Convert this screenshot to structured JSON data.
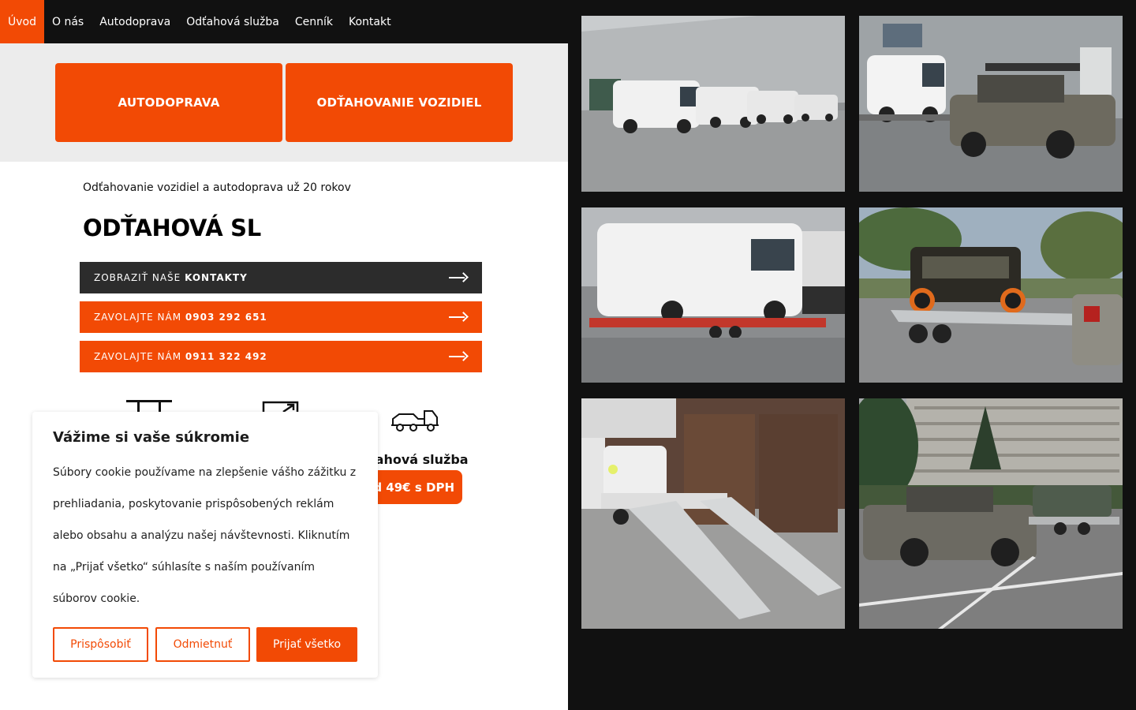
{
  "nav": {
    "items": [
      {
        "label": "Úvod",
        "active": true
      },
      {
        "label": "O nás"
      },
      {
        "label": "Autodoprava"
      },
      {
        "label": "Odťahová služba"
      },
      {
        "label": "Cenník"
      },
      {
        "label": "Kontakt"
      }
    ]
  },
  "hero": {
    "btn_transport": "AUTODOPRAVA",
    "btn_towing": "ODŤAHOVANIE VOZIDIEL"
  },
  "intro": {
    "tagline": "Odťahovanie vozidiel a autodoprava už 20 rokov",
    "headline": "ODŤAHOVÁ SL"
  },
  "cta": {
    "contacts_prefix": "ZOBRAZIŤ NAŠE",
    "contacts_bold": "KONTAKTY",
    "call_prefix": "ZAVOLAJTE NÁM",
    "phone_1": "0903 292 651",
    "phone_2": "0911 322 492"
  },
  "service": {
    "label": "ťahová služba",
    "price": "od 49€ s DPH"
  },
  "cookie": {
    "title": "Vážime si vaše súkromie",
    "text": "Súbory cookie používame na zlepšenie vášho zážitku z prehliadania, poskytovanie prispôsobených reklám alebo obsahu a analýzu našej návštevnosti. Kliknutím na „Prijať všetko“ súhlasíte s naším používaním súborov cookie.",
    "btn_customize": "Prispôsobiť",
    "btn_reject": "Odmietnuť",
    "btn_accept": "Prijať všetko"
  },
  "colors": {
    "accent": "#f24a05",
    "nav_bg": "#111111",
    "dark_button": "#2c2c2c",
    "band_bg": "#ececec"
  },
  "icons": [
    "car-lift-icon",
    "external-link-icon",
    "tow-truck-icon",
    "arrow-right-icon"
  ]
}
